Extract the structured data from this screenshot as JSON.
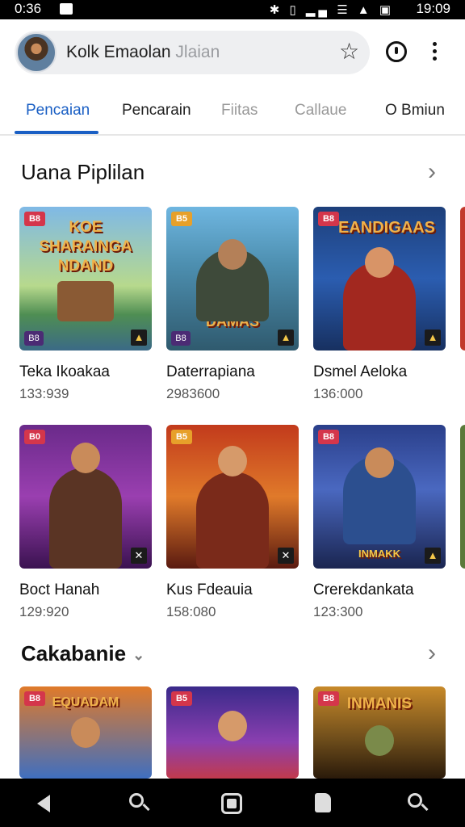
{
  "status_bar": {
    "time": "0:36",
    "clock": "19:09",
    "icons": "✱ ▯ ▂▄ ☰ ▲ ▣"
  },
  "search": {
    "text_main": "Kolk Emaolan",
    "text_faded": "Jlaian"
  },
  "tabs": [
    {
      "label": "Pencaian"
    },
    {
      "label": "Pencarain"
    },
    {
      "label": "Fiitas"
    },
    {
      "label": "Callaue"
    },
    {
      "label": "O Bmiun"
    }
  ],
  "sections": [
    {
      "title": "Uana Piplilan",
      "games": [
        {
          "title": "Teka Ikoakaa",
          "count": "133:939",
          "badge": "B8",
          "logo": "KOE SHARAINGA NDAND"
        },
        {
          "title": "Daterrapiana",
          "count": "2983600",
          "badge": "B5",
          "logo": "DAMAS"
        },
        {
          "title": "Dsmel Aeloka",
          "count": "136:000",
          "badge": "B8",
          "logo": "EANDIGAAS"
        }
      ]
    },
    {
      "games": [
        {
          "title": "Boct Hanah",
          "count": "129:920",
          "badge": "B0"
        },
        {
          "title": "Kus Fdeauia",
          "count": "158:080",
          "badge": "B5"
        },
        {
          "title": "Crerekdankata",
          "count": "123:300",
          "badge": "B8",
          "logo": "INMAKK"
        }
      ]
    },
    {
      "title": "Cakabanie",
      "games": [
        {
          "badge": "B8",
          "logo": "EQUADAM"
        },
        {
          "badge": "B5"
        },
        {
          "badge": "B8",
          "logo": "INMANIS"
        }
      ]
    }
  ],
  "colors": {
    "accent": "#1a5fc4",
    "badge": "#d4364b"
  }
}
